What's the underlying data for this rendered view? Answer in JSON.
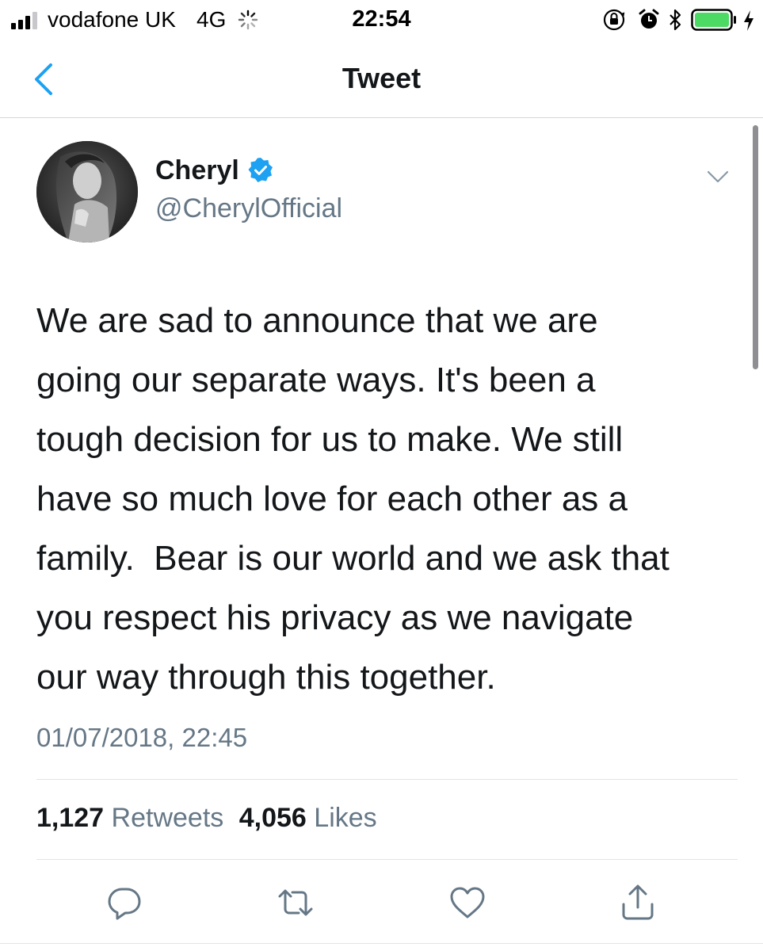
{
  "status_bar": {
    "carrier": "vodafone UK",
    "network": "4G",
    "time": "22:54"
  },
  "nav": {
    "title": "Tweet"
  },
  "tweet": {
    "display_name": "Cheryl",
    "handle": "@CherylOfficial",
    "verified": true,
    "text_lines": [
      "We are sad to announce that we are",
      "going our separate ways. It's been a",
      "tough decision for us to make. We still",
      "have so much love for each other as a",
      "family.  Bear is our world and we ask that",
      "you respect his privacy as we navigate",
      "our way through this together."
    ],
    "timestamp": "01/07/2018, 22:45"
  },
  "stats": {
    "retweets_count": "1,127",
    "retweets_label": "Retweets",
    "likes_count": "4,056",
    "likes_label": "Likes"
  },
  "colors": {
    "accent": "#1da1f2",
    "text": "#14171a",
    "secondary_text": "#657786",
    "icon_gray": "#657786",
    "divider": "#e1e5e8",
    "battery_green": "#4cd964"
  },
  "icons": {
    "back": "chevron-left-icon",
    "more": "chevron-down-icon",
    "reply": "reply-icon",
    "retweet": "retweet-icon",
    "like": "heart-icon",
    "share": "share-icon"
  }
}
